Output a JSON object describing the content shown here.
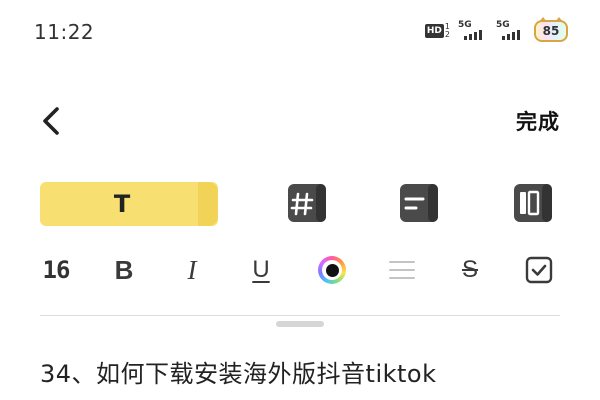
{
  "status_bar": {
    "time": "11:22",
    "hd_label": "HD",
    "sim1": "1",
    "sim2": "2",
    "network_1": "5G",
    "network_2": "5G",
    "battery_level": "85"
  },
  "nav": {
    "back_icon": "chevron-left-icon",
    "done_label": "完成"
  },
  "style_cards": {
    "text_style_glyph": "T",
    "text_style_color": "#f7e071",
    "icons": [
      "hashtag-icon",
      "list-lines-icon",
      "layout-columns-icon"
    ]
  },
  "format_toolbar": {
    "font_size": "16",
    "bold_glyph": "B",
    "italic_glyph": "I",
    "underline_glyph": "U",
    "strike_glyph": "S",
    "color_icon": "color-wheel-icon",
    "align_icon": "align-lines-icon",
    "checkbox_icon": "checkbox-icon"
  },
  "note": {
    "first_line": "34、如何下载安装海外版抖音tiktok"
  }
}
